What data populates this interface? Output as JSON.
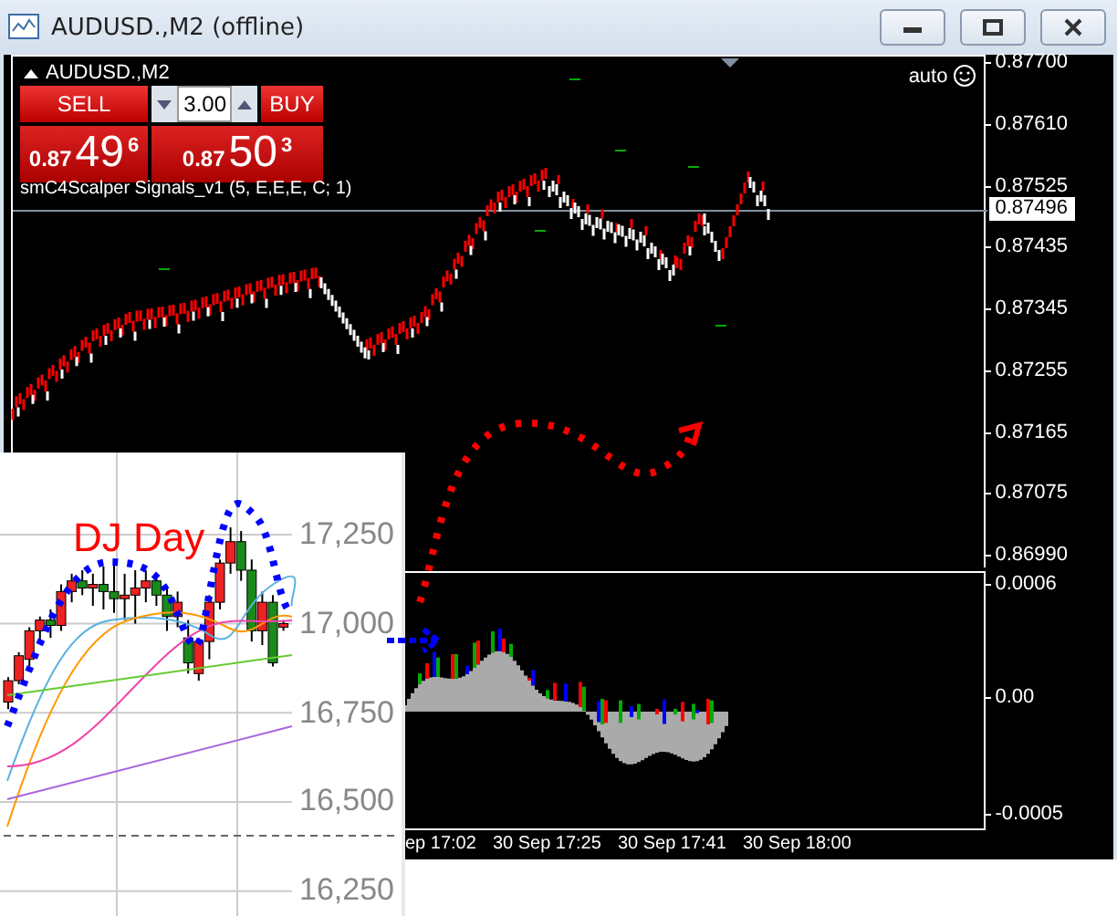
{
  "window": {
    "title": "AUDUSD.,M2 (offline)"
  },
  "chart": {
    "symbol": "AUDUSD.,M2",
    "scale_mode": "auto",
    "indicator_label": "smC4Scalper Signals_v1 (5, E,E,E, C; 1)",
    "trade_panel": {
      "sell_label": "SELL",
      "buy_label": "BUY",
      "lots": "3.00",
      "bid": {
        "prefix": "0.87",
        "big": "49",
        "small": "6"
      },
      "ask": {
        "prefix": "0.87",
        "big": "50",
        "small": "3"
      }
    },
    "price_axis": [
      "0.87700",
      "0.87610",
      "0.87525",
      "0.87435",
      "0.87345",
      "0.87255",
      "0.87165",
      "0.87075",
      "0.86990"
    ],
    "current_price": "0.87496",
    "sub_axis": [
      "0.0006",
      "0.00",
      "-0.0005"
    ],
    "time_axis": [
      "ep 17:02",
      "30 Sep 17:25",
      "30 Sep 17:41",
      "30 Sep 18:00"
    ]
  },
  "inset": {
    "title": "DJ Day",
    "chart_data": {
      "type": "candlestick",
      "grid": true,
      "ylim": [
        16180,
        17480
      ],
      "categories": [
        null,
        null,
        null,
        null,
        null,
        null,
        null,
        null,
        null,
        null,
        null,
        null,
        null,
        null,
        null,
        null,
        null,
        null,
        null,
        null,
        null,
        null,
        null,
        null,
        null,
        null,
        null
      ],
      "ohlc": [
        [
          16780,
          16850,
          16760,
          16840
        ],
        [
          16840,
          16920,
          16830,
          16910
        ],
        [
          16900,
          16990,
          16880,
          16980
        ],
        [
          16980,
          17020,
          16950,
          17010
        ],
        [
          17010,
          17040,
          16960,
          16995
        ],
        [
          16995,
          17110,
          16980,
          17090
        ],
        [
          17090,
          17140,
          17060,
          17120
        ],
        [
          17120,
          17150,
          17080,
          17100
        ],
        [
          17100,
          17140,
          17050,
          17110
        ],
        [
          17110,
          17160,
          17040,
          17090
        ],
        [
          17090,
          17170,
          17030,
          17070
        ],
        [
          17070,
          17140,
          17010,
          17080
        ],
        [
          17080,
          17150,
          17000,
          17100
        ],
        [
          17100,
          17150,
          17060,
          17120
        ],
        [
          17120,
          17140,
          17050,
          17080
        ],
        [
          17080,
          17100,
          16980,
          17020
        ],
        [
          17020,
          17090,
          16990,
          17060
        ],
        [
          16960,
          17010,
          16860,
          16890
        ],
        [
          16860,
          16960,
          16840,
          16950
        ],
        [
          16950,
          17080,
          16900,
          17060
        ],
        [
          17060,
          17180,
          17040,
          17170
        ],
        [
          17170,
          17270,
          17140,
          17230
        ],
        [
          17230,
          17260,
          17120,
          17150
        ],
        [
          17150,
          17180,
          16950,
          16980
        ],
        [
          16980,
          17090,
          16940,
          17060
        ],
        [
          17060,
          17080,
          16880,
          16890
        ],
        [
          16990,
          17010,
          16980,
          17000
        ]
      ],
      "yticks": [
        {
          "value": 17250,
          "label": "17,250"
        },
        {
          "value": 17000,
          "label": "17,000"
        },
        {
          "value": 16750,
          "label": "16,750"
        },
        {
          "value": 16500,
          "label": "16,500"
        },
        {
          "value": 16250,
          "label": "16,250"
        }
      ]
    }
  }
}
